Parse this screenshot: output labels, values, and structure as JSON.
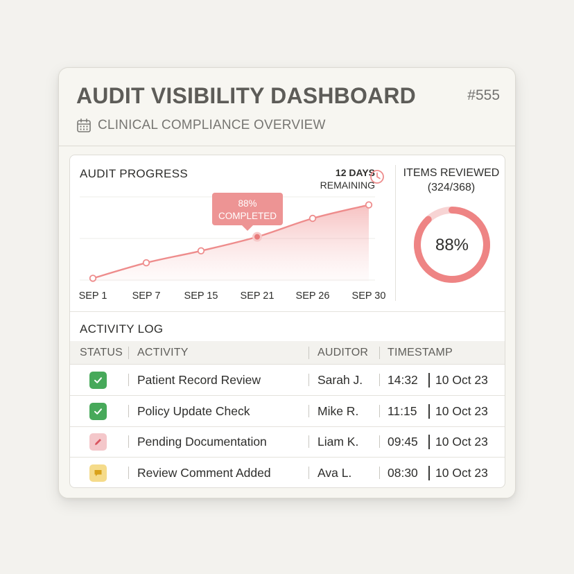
{
  "header": {
    "title": "AUDIT VISIBILITY DASHBOARD",
    "id": "#555",
    "subtitle": "CLINICAL COMPLIANCE OVERVIEW",
    "subtitle_icon": "calendar-icon"
  },
  "progress": {
    "title": "AUDIT PROGRESS",
    "days_remaining": "12 DAYS",
    "remaining_label": "REMAINING",
    "clock_icon": "clock-icon",
    "tooltip_value": "88%",
    "tooltip_label": "COMPLETED",
    "tooltip_index": 3,
    "accent_color": "#ee8c8c"
  },
  "chart_data": {
    "type": "area",
    "categories": [
      "SEP 1",
      "SEP 7",
      "SEP 15",
      "SEP 21",
      "SEP 26",
      "SEP 30"
    ],
    "values": [
      5,
      36,
      60,
      88,
      125,
      152
    ],
    "grid": true
  },
  "reviewed": {
    "title": "ITEMS REVIEWED",
    "count": "(324/368)",
    "percent_label": "88%",
    "fraction": 0.88
  },
  "log": {
    "title": "ACTIVITY LOG",
    "columns": [
      "STATUS",
      "ACTIVITY",
      "AUDITOR",
      "TIMESTAMP"
    ],
    "rows": [
      {
        "status": "completed",
        "status_icon": "check-icon",
        "activity": "Patient Record Review",
        "auditor": "Sarah J.",
        "time": "14:32",
        "date": "10 Oct 23"
      },
      {
        "status": "completed",
        "status_icon": "check-icon",
        "activity": "Policy Update Check",
        "auditor": "Mike R.",
        "time": "11:15",
        "date": "10 Oct 23"
      },
      {
        "status": "pending",
        "status_icon": "pencil-icon",
        "activity": "Pending Documentation",
        "auditor": "Liam K.",
        "time": "09:45",
        "date": "10 Oct 23"
      },
      {
        "status": "comment",
        "status_icon": "comment-icon",
        "activity": "Review Comment Added",
        "auditor": "Ava L.",
        "time": "08:30",
        "date": "10 Oct 23"
      }
    ]
  },
  "colors": {
    "done": "#47a95a",
    "pending": "#f4c7ca",
    "comment": "#f5db8a",
    "accent": "#ee8c8c"
  }
}
